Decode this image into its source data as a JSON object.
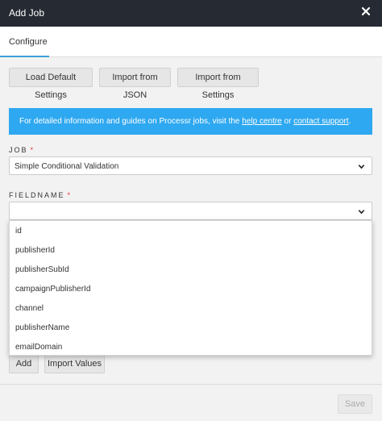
{
  "header": {
    "title": "Add Job",
    "close_icon": "close-icon"
  },
  "tabs": [
    {
      "label": "Configure",
      "active": true
    }
  ],
  "toolbar": {
    "load_defaults_label": "Load Default Settings",
    "import_json_label": "Import from JSON",
    "import_settings_label": "Import from Settings"
  },
  "info": {
    "text_before": "For detailed information and guides on Processr jobs, visit the ",
    "help_link": "help centre",
    "text_middle": " or ",
    "support_link": "contact support",
    "text_after": ".",
    "background": "#2ea8f0"
  },
  "job": {
    "label": "JOB",
    "required_mark": "*",
    "selected": "Simple Conditional Validation"
  },
  "fieldname": {
    "label": "FIELDNAME",
    "required_mark": "*",
    "selected": "",
    "options": [
      "id",
      "publisherId",
      "publisherSubId",
      "campaignPublisherId",
      "channel",
      "publisherName",
      "emailDomain"
    ]
  },
  "values": {
    "add_label": "Add",
    "import_values_label": "Import Values"
  },
  "footer": {
    "save_label": "Save"
  },
  "colors": {
    "titlebar": "#252a33",
    "accent": "#3aa3d9",
    "required": "#e0302a"
  }
}
